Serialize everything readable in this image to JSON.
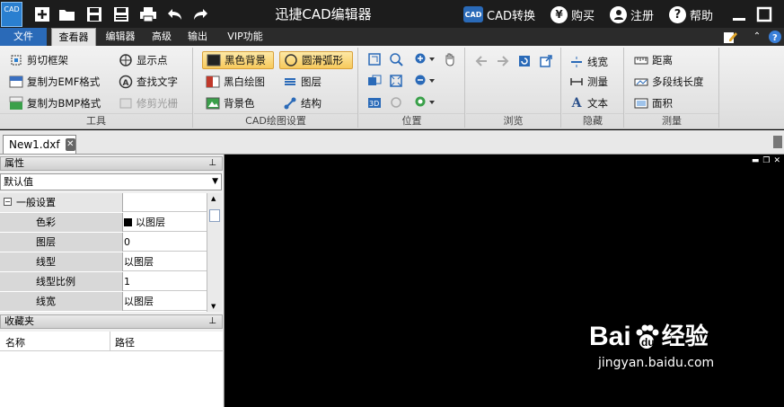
{
  "app": {
    "title": "迅捷CAD编辑器",
    "logo_text": "CAD"
  },
  "titlebar_right": {
    "convert_label": "CAD转换",
    "buy_label": "购买",
    "register_label": "注册",
    "help_label": "帮助",
    "convert_badge": "CAD",
    "buy_badge": "¥",
    "help_badge": "?"
  },
  "menu": {
    "file": "文件",
    "viewer": "查看器",
    "editor": "编辑器",
    "advanced": "高级",
    "output": "输出",
    "vip": "VIP功能"
  },
  "ribbon": {
    "tools": {
      "label": "工具",
      "clip_frame": "剪切框架",
      "copy_emf": "复制为EMF格式",
      "copy_bmp": "复制为BMP格式",
      "show_points": "显示点",
      "find_text": "查找文字",
      "trim_raster": "修剪光栅",
      "bmp_tag": "BMP",
      "emf_tag": "EMF"
    },
    "cad_settings": {
      "label": "CAD绘图设置",
      "black_bg": "黑色背景",
      "smooth_arc": "圆滑弧形",
      "bw_drawing": "黑白绘图",
      "layers": "图层",
      "bg_color": "背景色",
      "structure": "结构"
    },
    "position": {
      "label": "位置",
      "tag_3d": "3D"
    },
    "browse": {
      "label": "浏览"
    },
    "hide": {
      "label": "隐藏",
      "line_width": "线宽",
      "measure": "测量",
      "text": "文本"
    },
    "measure": {
      "label": "测量",
      "distance": "距离",
      "polyline_length": "多段线长度",
      "area": "面积"
    }
  },
  "doc": {
    "tab_name": "New1.dxf"
  },
  "properties": {
    "title": "属性",
    "combo_value": "默认值",
    "section": "一般设置",
    "rows": [
      {
        "key": "色彩",
        "value": "以图层"
      },
      {
        "key": "图层",
        "value": "0"
      },
      {
        "key": "线型",
        "value": "以图层"
      },
      {
        "key": "线型比例",
        "value": "1"
      },
      {
        "key": "线宽",
        "value": "以图层"
      }
    ]
  },
  "favorites": {
    "title": "收藏夹",
    "col_name": "名称",
    "col_path": "路径"
  },
  "watermark": {
    "brand_a": "Bai",
    "brand_b": "du",
    "brand_cn": "经验",
    "url": "jingyan.baidu.com"
  },
  "colors": {
    "titlebar": "#1c1c1c",
    "menubar": "#2b2b2b",
    "file_tab": "#2a6ab8",
    "canvas": "#000000",
    "highlight": "#f7c95c"
  }
}
